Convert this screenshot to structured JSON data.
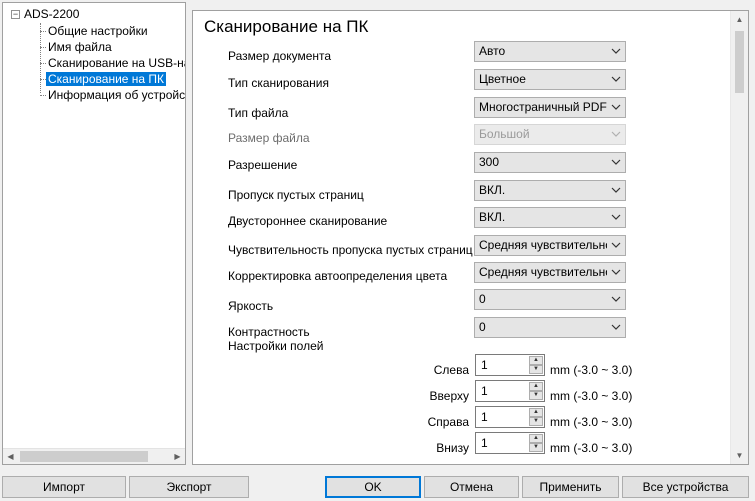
{
  "tree": {
    "root": {
      "label": "ADS-2200",
      "toggle": "−"
    },
    "items": [
      {
        "label": "Общие настройки",
        "selected": false
      },
      {
        "label": "Имя файла",
        "selected": false
      },
      {
        "label": "Сканирование на USB-нако",
        "selected": false
      },
      {
        "label": "Сканирование на ПК",
        "selected": true
      },
      {
        "label": "Информация об устройстве",
        "selected": false
      }
    ]
  },
  "panel": {
    "title": "Сканирование на ПК",
    "settings": [
      {
        "label": "Размер документа",
        "value": "Авто",
        "disabled": false
      },
      {
        "label": "Тип сканирования",
        "value": "Цветное",
        "disabled": false
      },
      {
        "label": "Тип файла",
        "value": "Многостраничный PDF",
        "disabled": false
      },
      {
        "label": "Размер файла",
        "value": "Большой",
        "disabled": true
      },
      {
        "label": "Разрешение",
        "value": "300",
        "disabled": false
      },
      {
        "label": "Пропуск пустых страниц",
        "value": "ВКЛ.",
        "disabled": false
      },
      {
        "label": "Двустороннее сканирование",
        "value": "ВКЛ.",
        "disabled": false
      },
      {
        "label": "Чувствительность пропуска пустых страниц",
        "value": "Средняя чувствительность",
        "disabled": false
      },
      {
        "label": "Корректировка автоопределения цвета",
        "value": "Средняя чувствительность",
        "disabled": false
      },
      {
        "label": "Яркость",
        "value": "0",
        "disabled": false
      },
      {
        "label": "Контрастность",
        "value": "0",
        "disabled": false
      }
    ],
    "margins_heading": "Настройки полей",
    "margins": [
      {
        "label": "Слева",
        "value": "1",
        "unit": "mm (-3.0 ~ 3.0)"
      },
      {
        "label": "Вверху",
        "value": "1",
        "unit": "mm (-3.0 ~ 3.0)"
      },
      {
        "label": "Справа",
        "value": "1",
        "unit": "mm (-3.0 ~ 3.0)"
      },
      {
        "label": "Внизу",
        "value": "1",
        "unit": "mm (-3.0 ~ 3.0)"
      }
    ]
  },
  "buttons": {
    "import": "Импорт",
    "export": "Экспорт",
    "ok": "OK",
    "cancel": "Отмена",
    "apply": "Применить",
    "all_devices": "Все устройства"
  },
  "colors": {
    "selection": "#0078d7",
    "default_button_border": "#0078d7"
  }
}
